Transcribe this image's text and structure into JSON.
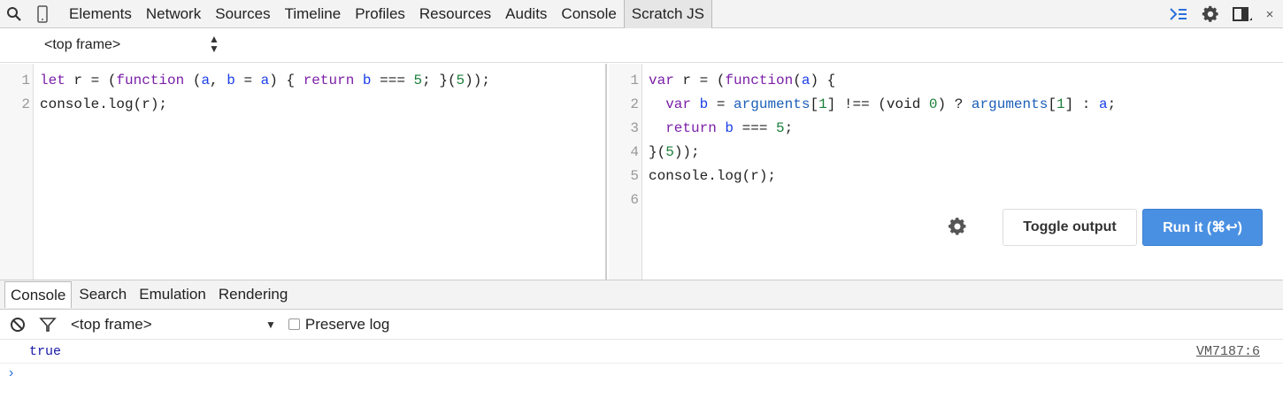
{
  "toolbar": {
    "icons": {
      "search": "search-icon",
      "device": "device-mode-icon",
      "drawer": "show-drawer-icon",
      "settings": "gear-icon",
      "dock": "dock-side-icon"
    },
    "tabs": [
      {
        "label": "Elements"
      },
      {
        "label": "Network"
      },
      {
        "label": "Sources"
      },
      {
        "label": "Timeline"
      },
      {
        "label": "Profiles"
      },
      {
        "label": "Resources"
      },
      {
        "label": "Audits"
      },
      {
        "label": "Console"
      },
      {
        "label": "Scratch JS"
      }
    ],
    "active_tab": "Scratch JS",
    "close": "×"
  },
  "frame_selector": {
    "value": "<top frame>"
  },
  "left_editor": {
    "line_numbers": [
      "1",
      "2"
    ],
    "lines": [
      [
        {
          "t": "let",
          "c": "kw"
        },
        {
          "t": " r = (",
          "c": ""
        },
        {
          "t": "function",
          "c": "kw"
        },
        {
          "t": " (",
          "c": ""
        },
        {
          "t": "a",
          "c": "var"
        },
        {
          "t": ", ",
          "c": ""
        },
        {
          "t": "b",
          "c": "var"
        },
        {
          "t": " = ",
          "c": ""
        },
        {
          "t": "a",
          "c": "var"
        },
        {
          "t": ") { ",
          "c": ""
        },
        {
          "t": "return",
          "c": "kw"
        },
        {
          "t": " ",
          "c": ""
        },
        {
          "t": "b",
          "c": "var"
        },
        {
          "t": " === ",
          "c": ""
        },
        {
          "t": "5",
          "c": "num"
        },
        {
          "t": "; }(",
          "c": ""
        },
        {
          "t": "5",
          "c": "num"
        },
        {
          "t": "));",
          "c": ""
        }
      ],
      [
        {
          "t": "console.log(r);",
          "c": ""
        }
      ]
    ]
  },
  "right_editor": {
    "line_numbers": [
      "1",
      "2",
      "3",
      "4",
      "5",
      "6"
    ],
    "lines": [
      [
        {
          "t": "var",
          "c": "kw"
        },
        {
          "t": " r = (",
          "c": ""
        },
        {
          "t": "function",
          "c": "kw"
        },
        {
          "t": "(",
          "c": ""
        },
        {
          "t": "a",
          "c": "var"
        },
        {
          "t": ") {",
          "c": ""
        }
      ],
      [
        {
          "t": "  ",
          "c": ""
        },
        {
          "t": "var",
          "c": "kw"
        },
        {
          "t": " ",
          "c": ""
        },
        {
          "t": "b",
          "c": "var"
        },
        {
          "t": " = ",
          "c": ""
        },
        {
          "t": "arguments",
          "c": "prop"
        },
        {
          "t": "[",
          "c": ""
        },
        {
          "t": "1",
          "c": "num"
        },
        {
          "t": "] !== (void ",
          "c": ""
        },
        {
          "t": "0",
          "c": "num"
        },
        {
          "t": ") ? ",
          "c": ""
        },
        {
          "t": "arguments",
          "c": "prop"
        },
        {
          "t": "[",
          "c": ""
        },
        {
          "t": "1",
          "c": "num"
        },
        {
          "t": "] : ",
          "c": ""
        },
        {
          "t": "a",
          "c": "var"
        },
        {
          "t": ";",
          "c": ""
        }
      ],
      [
        {
          "t": "  ",
          "c": ""
        },
        {
          "t": "return",
          "c": "kw"
        },
        {
          "t": " ",
          "c": ""
        },
        {
          "t": "b",
          "c": "var"
        },
        {
          "t": " === ",
          "c": ""
        },
        {
          "t": "5",
          "c": "num"
        },
        {
          "t": ";",
          "c": ""
        }
      ],
      [
        {
          "t": "}(",
          "c": ""
        },
        {
          "t": "5",
          "c": "num"
        },
        {
          "t": "));",
          "c": ""
        }
      ],
      [
        {
          "t": "console.log(r);",
          "c": ""
        }
      ],
      []
    ],
    "toggle_output_label": "Toggle output",
    "run_label": "Run it (⌘↩)"
  },
  "drawer": {
    "tabs": [
      {
        "label": "Console"
      },
      {
        "label": "Search"
      },
      {
        "label": "Emulation"
      },
      {
        "label": "Rendering"
      }
    ],
    "active_tab": "Console"
  },
  "console": {
    "frame": "<top frame>",
    "preserve_log_label": "Preserve log",
    "preserve_log_checked": false,
    "messages": [
      {
        "text": "true",
        "source": "VM7187:6"
      }
    ],
    "prompt": "›"
  },
  "colors": {
    "keyword": "#7a1fa8",
    "variable": "#1a3fe8",
    "number": "#1b7f3a",
    "property": "#1c5fb8",
    "run_button": "#4a90e2",
    "console_value": "#1a1aa6"
  }
}
